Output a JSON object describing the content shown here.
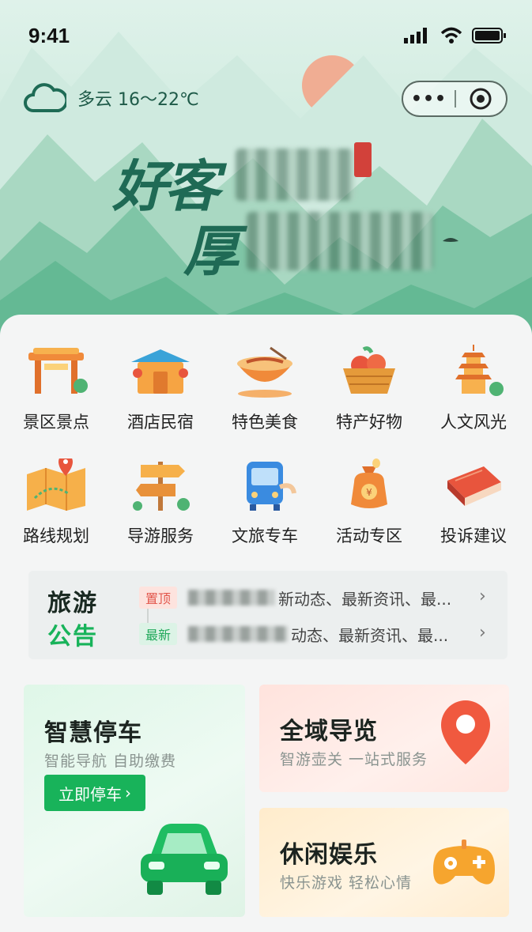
{
  "status_bar": {
    "time": "9:41"
  },
  "weather": {
    "text": "多云 16～22℃",
    "icon": "cloud-icon"
  },
  "capsule": {
    "more_icon": "more-dots-icon",
    "close_icon": "target-icon",
    "dots": "•••"
  },
  "hero": {
    "slogan_line1": "好客",
    "slogan_line2": "厚"
  },
  "services": [
    {
      "label": "景区景点",
      "icon": "gate-icon"
    },
    {
      "label": "酒店民宿",
      "icon": "hotel-icon"
    },
    {
      "label": "特色美食",
      "icon": "bowl-icon"
    },
    {
      "label": "特产好物",
      "icon": "basket-icon"
    },
    {
      "label": "人文风光",
      "icon": "pagoda-icon"
    },
    {
      "label": "路线规划",
      "icon": "map-icon"
    },
    {
      "label": "导游服务",
      "icon": "signpost-icon"
    },
    {
      "label": "文旅专车",
      "icon": "bus-icon"
    },
    {
      "label": "活动专区",
      "icon": "money-bag-icon"
    },
    {
      "label": "投诉建议",
      "icon": "book-icon"
    }
  ],
  "notice": {
    "title_line1": "旅游",
    "title_line2": "公告",
    "items": [
      {
        "tag": "置顶",
        "text": "新动态、最新资讯、最..."
      },
      {
        "tag": "最新",
        "text": "动态、最新资讯、最..."
      }
    ],
    "arrow": "›"
  },
  "tiles": {
    "parking": {
      "title": "智慧停车",
      "subtitle": "智能导航 自助缴费",
      "button": "立即停车"
    },
    "guide": {
      "title": "全域导览",
      "subtitle": "智游壶关 一站式服务"
    },
    "leisure": {
      "title": "休闲娱乐",
      "subtitle": "快乐游戏 轻松心情"
    }
  }
}
